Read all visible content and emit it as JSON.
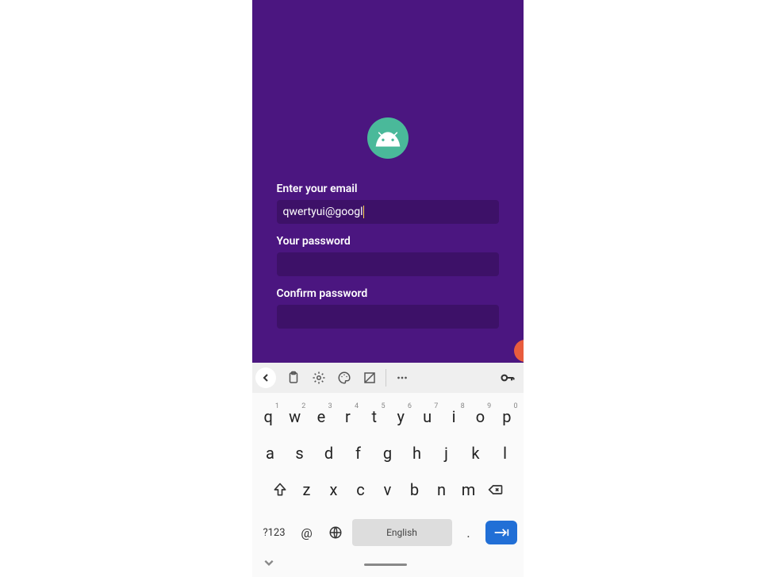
{
  "form": {
    "email_label": "Enter your email",
    "email_value": "qwertyui@googl",
    "password_label": "Your password",
    "confirm_label": "Confirm password"
  },
  "keyboard": {
    "row1": [
      {
        "k": "q",
        "n": "1"
      },
      {
        "k": "w",
        "n": "2"
      },
      {
        "k": "e",
        "n": "3"
      },
      {
        "k": "r",
        "n": "4"
      },
      {
        "k": "t",
        "n": "5"
      },
      {
        "k": "y",
        "n": "6"
      },
      {
        "k": "u",
        "n": "7"
      },
      {
        "k": "i",
        "n": "8"
      },
      {
        "k": "o",
        "n": "9"
      },
      {
        "k": "p",
        "n": "0"
      }
    ],
    "row2": [
      "a",
      "s",
      "d",
      "f",
      "g",
      "h",
      "j",
      "k",
      "l"
    ],
    "row3": [
      "z",
      "x",
      "c",
      "v",
      "b",
      "n",
      "m"
    ],
    "symLabel": "?123",
    "at": "@",
    "dot": ".",
    "spaceLabel": "English"
  }
}
